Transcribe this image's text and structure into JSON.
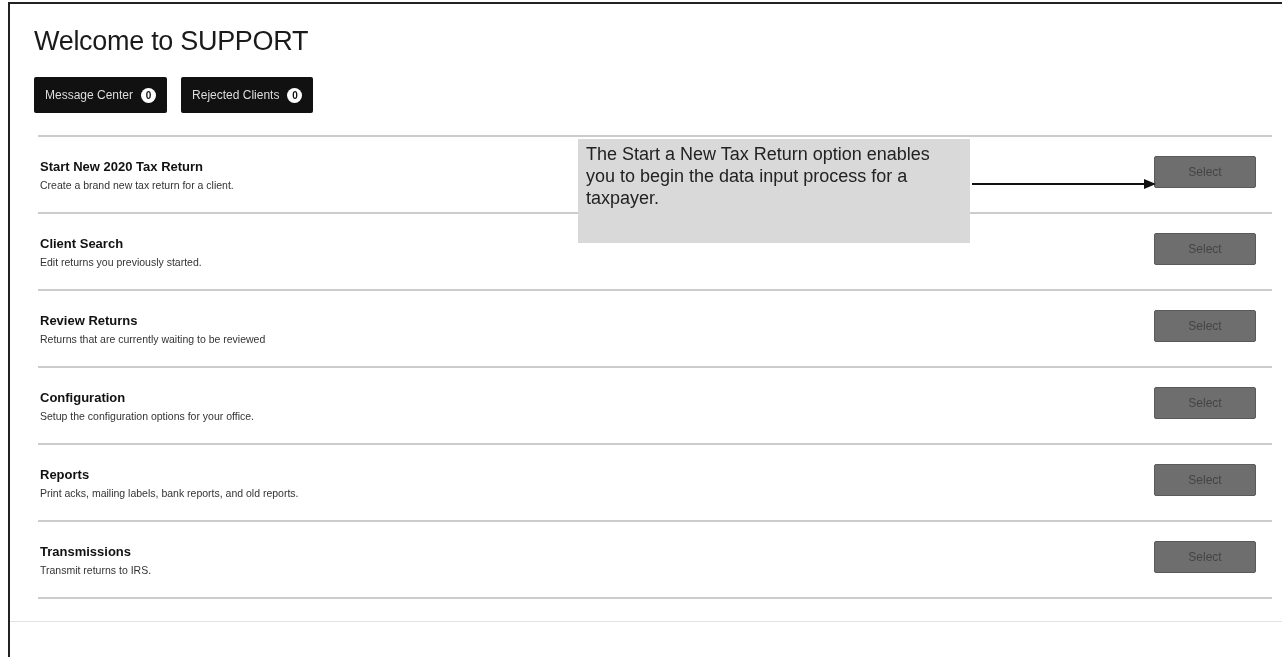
{
  "title": "Welcome to SUPPORT",
  "header_buttons": [
    {
      "label": "Message Center",
      "count": "0"
    },
    {
      "label": "Rejected Clients",
      "count": "0"
    }
  ],
  "options": [
    {
      "title": "Start New 2020 Tax Return",
      "description": "Create a brand new tax return for a client.",
      "button": "Select"
    },
    {
      "title": "Client Search",
      "description": "Edit returns you previously started.",
      "button": "Select"
    },
    {
      "title": "Review Returns",
      "description": "Returns that are currently waiting to be reviewed",
      "button": "Select"
    },
    {
      "title": "Configuration",
      "description": "Setup the configuration options for your office.",
      "button": "Select"
    },
    {
      "title": "Reports",
      "description": "Print acks, mailing labels, bank reports, and old reports.",
      "button": "Select"
    },
    {
      "title": "Transmissions",
      "description": "Transmit returns to IRS.",
      "button": "Select"
    }
  ],
  "callout": {
    "text": "The Start a New Tax Return option enables you to begin the data input process for a taxpayer."
  }
}
